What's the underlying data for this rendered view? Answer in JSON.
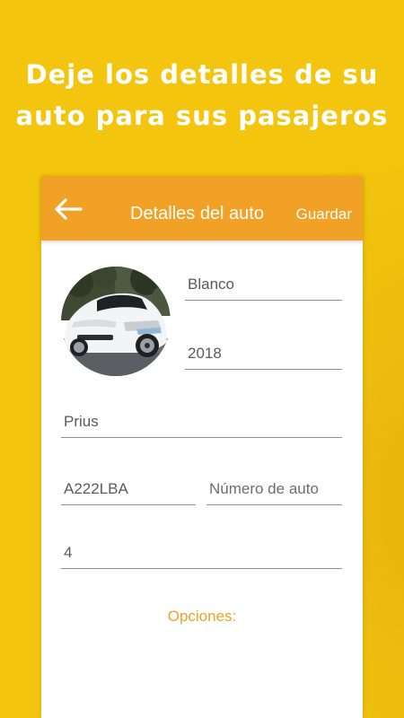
{
  "headline": {
    "line1": "Deje los detalles de su",
    "line2": "auto para sus pasajeros"
  },
  "app_bar": {
    "back_icon": "arrow-left-icon",
    "title": "Detalles del auto",
    "save_label": "Guardar"
  },
  "colors": {
    "background": "#f3c50e",
    "accent": "#f0a126",
    "text_on_accent": "#ffffff"
  },
  "form": {
    "color": "Blanco",
    "year": "2018",
    "model": "Prius",
    "plate": "A222LBA",
    "car_number_placeholder": "Número de auto",
    "seats": "4",
    "options_label": "Opciones:"
  }
}
